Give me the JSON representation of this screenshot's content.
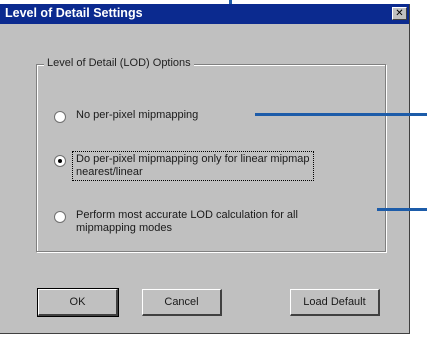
{
  "window": {
    "title": "Level of Detail Settings",
    "close_glyph": "✕"
  },
  "group": {
    "legend": "Level of Detail (LOD) Options"
  },
  "options": [
    {
      "label": "No per-pixel mipmapping",
      "checked": false
    },
    {
      "label_line1": "Do per-pixel mipmapping only for linear mipmap",
      "label_line2": "nearest/linear",
      "checked": true
    },
    {
      "label_line1": "Perform most accurate LOD calculation for all",
      "label_line2": "mipmapping modes",
      "checked": false
    }
  ],
  "buttons": {
    "ok": "OK",
    "cancel": "Cancel",
    "load_default": "Load Default"
  },
  "colors": {
    "titlebar": "#0b2a8f",
    "dialog_face": "#c0c0c0",
    "callout_line": "#1d5ca9"
  }
}
